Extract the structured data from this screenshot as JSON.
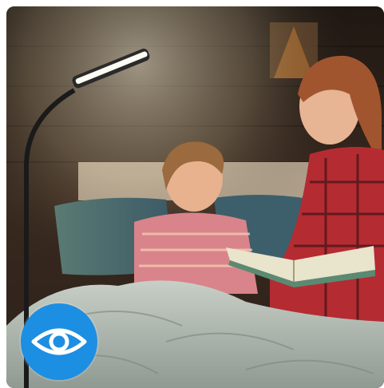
{
  "photo": {
    "subject": "",
    "colors": {
      "wall_dark": "#2b2019",
      "wood_mid": "#4a3526",
      "lamp_light": "#f4f1e6",
      "dress_pink": "#d9848a",
      "plaid_red": "#b52b32",
      "blanket": "#c9cec4",
      "book_page": "#e9e4cc"
    }
  },
  "badge": {
    "icon": "eye-icon",
    "color": "#1c8fe3"
  }
}
